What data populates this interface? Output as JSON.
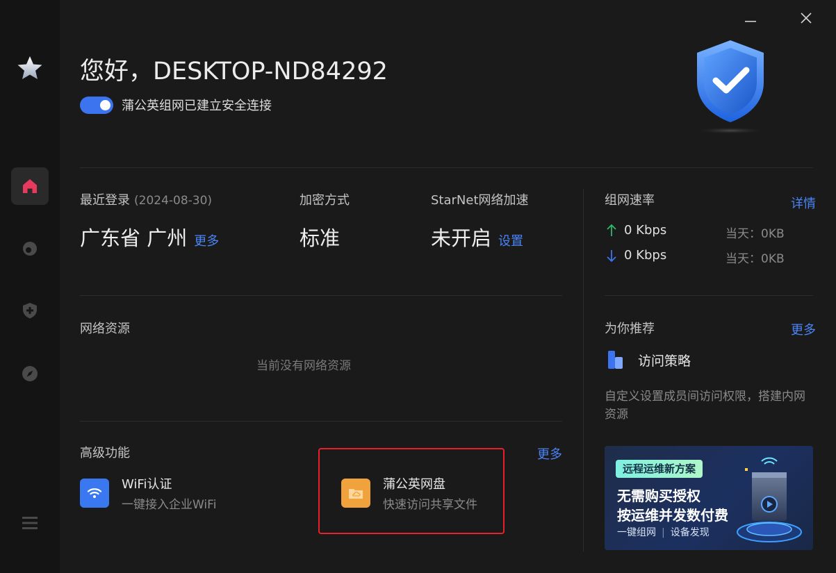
{
  "header": {
    "greeting": "您好，DESKTOP-ND84292",
    "connection_text": "蒲公英组网已建立安全连接",
    "connection_enabled": true
  },
  "colors": {
    "accent": "#3c74f0",
    "link": "#4a84f5",
    "highlight_border": "#e8202a",
    "wifi_icon_bg": "#3a78f2",
    "disk_icon_bg": "#f0a23c"
  },
  "icons": {
    "logo": "star-icon",
    "window_minimize": "minimize-icon",
    "window_close": "close-icon",
    "shield": "shield-check-icon",
    "upload": "arrow-up-icon",
    "download": "arrow-down-icon",
    "wifi": "wifi-icon",
    "cloud_disk": "cloud-folder-icon",
    "access_policy": "access-policy-icon"
  },
  "sidebar": {
    "items": [
      {
        "name": "home",
        "icon": "home-icon",
        "active": true
      },
      {
        "name": "network",
        "icon": "network-icon",
        "active": false
      },
      {
        "name": "security",
        "icon": "shield-plus-icon",
        "active": false
      },
      {
        "name": "discover",
        "icon": "compass-icon",
        "active": false
      }
    ],
    "menu_icon": "hamburger-menu-icon"
  },
  "stats": {
    "recent_login_label": "最近登录",
    "recent_login_date": "(2024-08-30)",
    "recent_login_location": "广东省 广州",
    "recent_login_more": "更多",
    "encryption_label": "加密方式",
    "encryption_value": "标准",
    "starnet_label": "StarNet网络加速",
    "starnet_value": "未开启",
    "starnet_settings": "设置"
  },
  "rate": {
    "title": "组网速率",
    "details": "详情",
    "upload": "0 Kbps",
    "download": "0 Kbps",
    "upload_today": "当天：0KB",
    "download_today": "当天：0KB"
  },
  "resources": {
    "title": "网络资源",
    "empty_text": "当前没有网络资源"
  },
  "features": {
    "title": "高级功能",
    "more": "更多",
    "items": [
      {
        "title": "WiFi认证",
        "subtitle": "一键接入企业WiFi"
      },
      {
        "title": "蒲公英网盘",
        "subtitle": "快速访问共享文件"
      }
    ]
  },
  "recommend": {
    "title": "为你推荐",
    "more": "更多",
    "item_title": "访问策略",
    "item_desc": "自定义设置成员间访问权限，搭建内网资源",
    "banner": {
      "tag": "远程运维新方案",
      "line1": "无需购买授权",
      "line2": "按运维并发数付费",
      "foot1": "一键组网",
      "foot_sep": "|",
      "foot2": "设备发现"
    }
  }
}
